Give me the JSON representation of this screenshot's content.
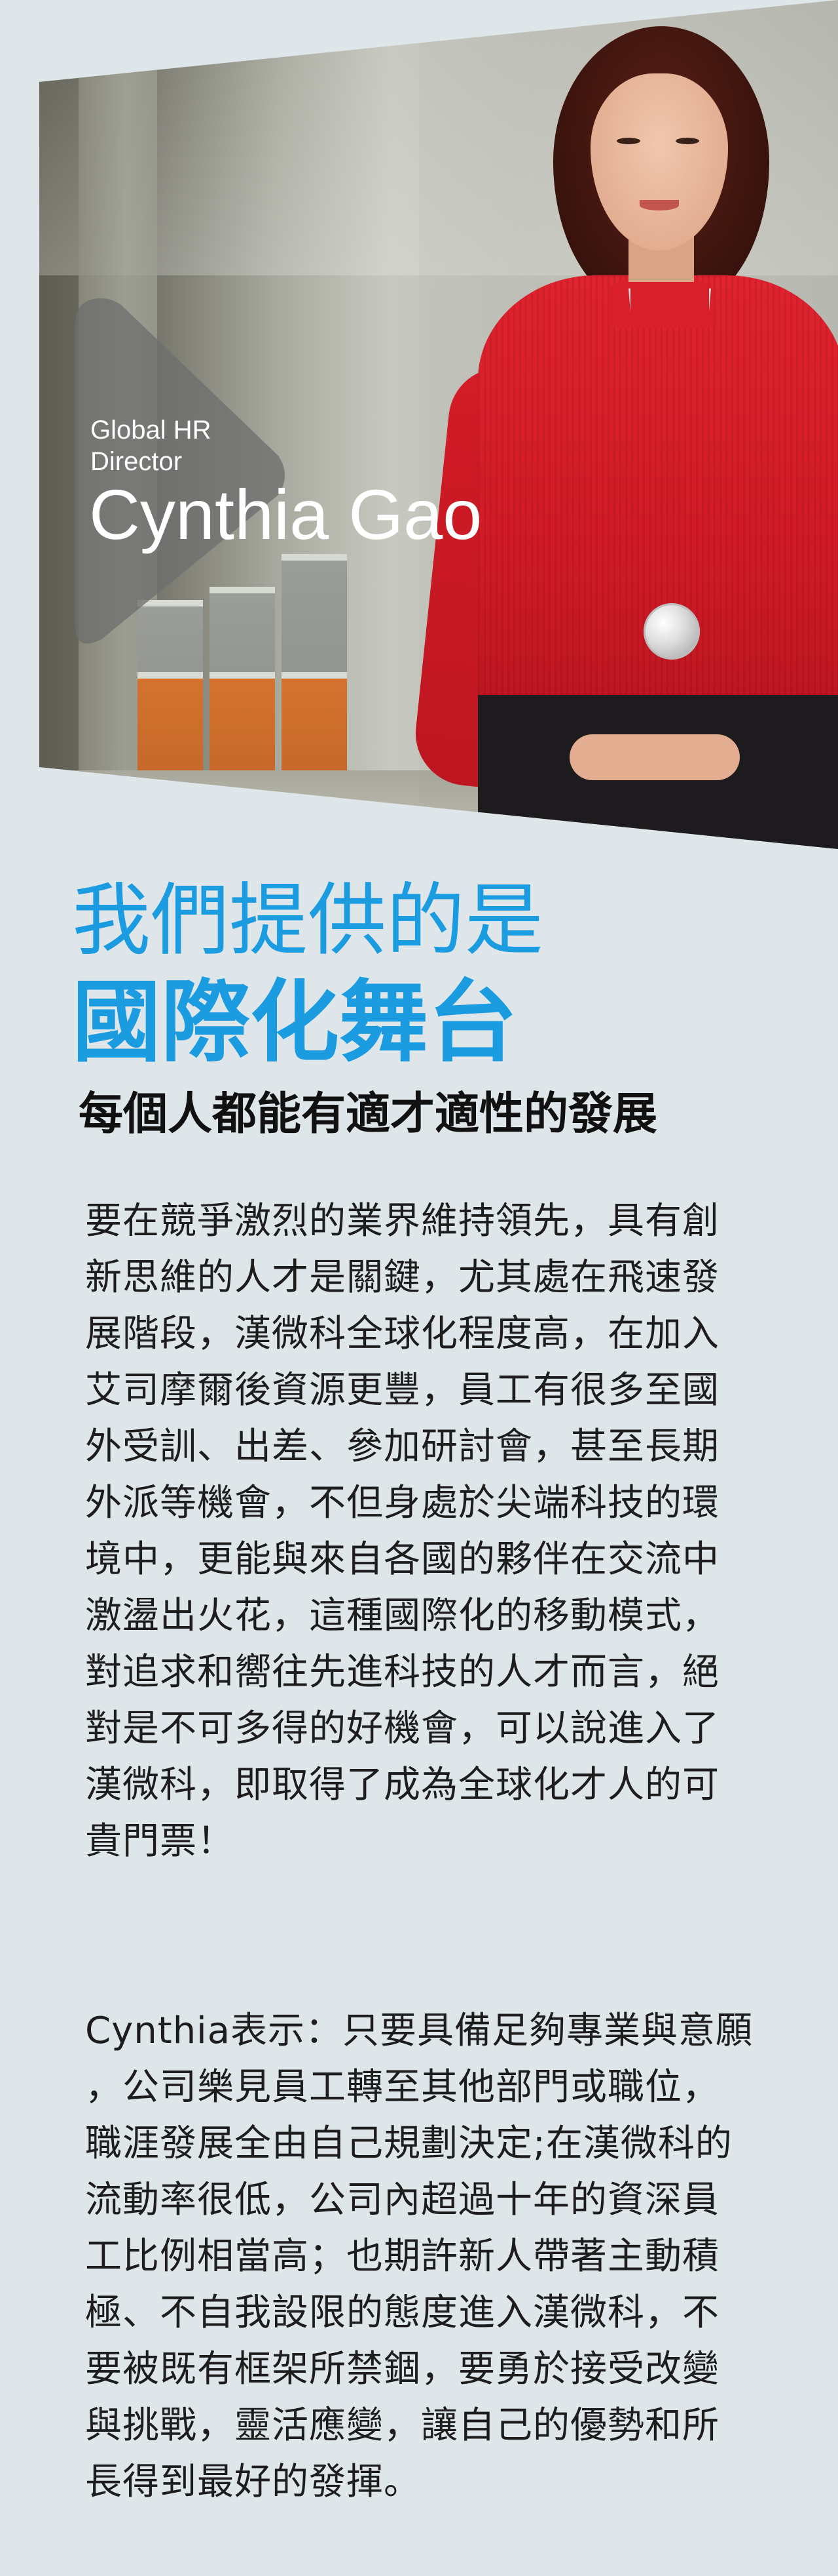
{
  "profile": {
    "role": "Global HR Director",
    "name": "Cynthia Gao"
  },
  "headline": {
    "light": "我們提供的是",
    "bold": "國際化舞台",
    "sub": "每個人都能有適才適性的發展"
  },
  "paragraph1": [
    "要在競爭激烈的業界維持領先，具有創",
    "新思維的人才是關鍵，尤其處在飛速發",
    "展階段，漢微科全球化程度高，在加入",
    "艾司摩爾後資源更豐，員工有很多至國",
    "外受訓、出差、參加研討會，甚至長期",
    "外派等機會，不但身處於尖端科技的環",
    "境中，更能與來自各國的夥伴在交流中",
    "激盪出火花，這種國際化的移動模式，",
    "對追求和嚮往先進科技的人才而言，絕",
    "對是不可多得的好機會，可以說進入了",
    "漢微科，即取得了成為全球化才人的可",
    "貴門票！"
  ],
  "paragraph2": [
    "Cynthia表示：只要具備足夠專業與意願",
    "，公司樂見員工轉至其他部門或職位，",
    "職涯發展全由自己規劃決定;在漢微科的",
    "流動率很低，公司內超過十年的資深員",
    "工比例相當高；也期許新人帶著主動積",
    "極、不自我設限的態度進入漢微科，不",
    "要被既有框架所禁錮，要勇於接受改變",
    "與挑戰，靈活應變，讓自己的優勢和所",
    "長得到最好的發揮。"
  ],
  "colors": {
    "background": "#dfe6e9",
    "accent_blue": "#1b9be0",
    "text": "#1d1d1d",
    "sweater_red": "#d01a25"
  }
}
